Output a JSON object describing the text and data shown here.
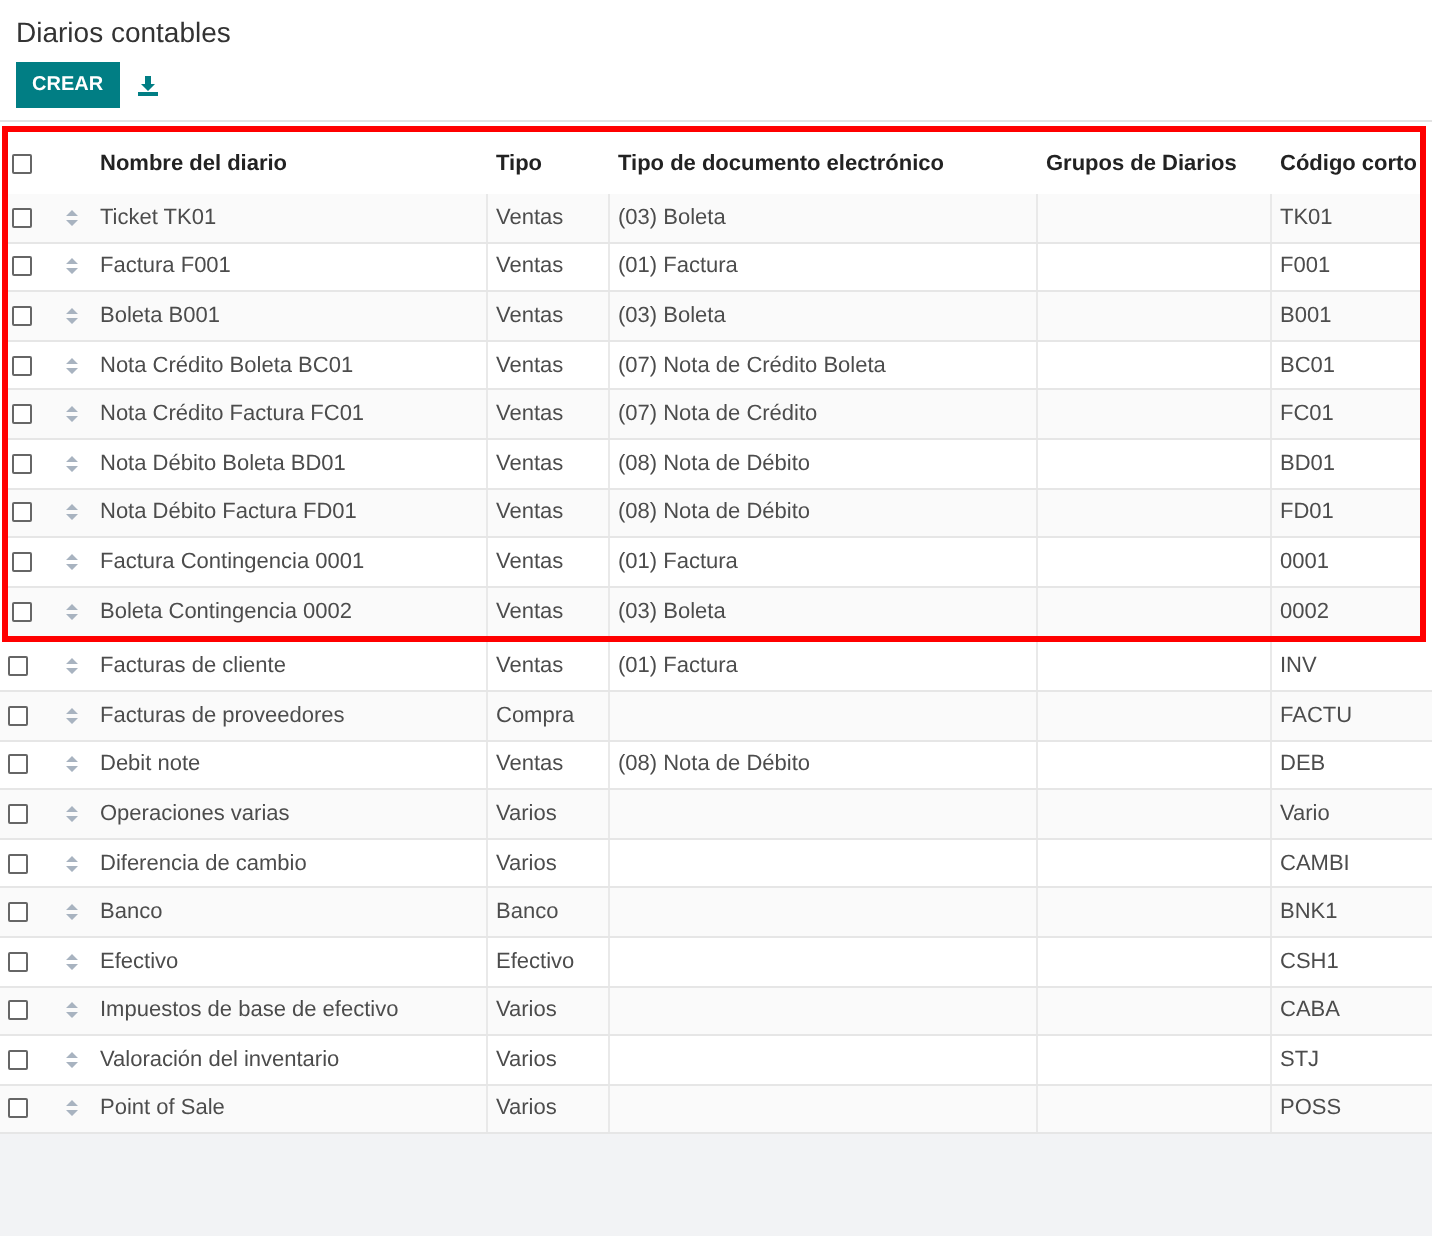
{
  "title": "Diarios contables",
  "create_button": "CREAR",
  "select_all": {
    "selected": false
  },
  "columns": [
    "Nombre del diario",
    "Tipo",
    "Tipo de documento electrónico",
    "Grupos de Diarios",
    "Código corto"
  ],
  "rows": [
    {
      "name": "Ticket TK01",
      "type": "Ventas",
      "document_type": "(03) Boleta",
      "code": "TK01",
      "selected": false,
      "highlighted": true
    },
    {
      "name": "Factura F001",
      "type": "Ventas",
      "document_type": "(01) Factura",
      "code": "F001",
      "selected": false,
      "highlighted": true
    },
    {
      "name": "Boleta B001",
      "type": "Ventas",
      "document_type": "(03) Boleta",
      "code": "B001",
      "selected": false,
      "highlighted": true
    },
    {
      "name": "Nota Crédito Boleta BC01",
      "type": "Ventas",
      "document_type": "(07) Nota de Crédito Boleta",
      "code": "BC01",
      "selected": false,
      "highlighted": true
    },
    {
      "name": "Nota Crédito Factura FC01",
      "type": "Ventas",
      "document_type": "(07) Nota de Crédito",
      "code": "FC01",
      "selected": false,
      "highlighted": true
    },
    {
      "name": "Nota Débito Boleta BD01",
      "type": "Ventas",
      "document_type": "(08) Nota de Débito",
      "code": "BD01",
      "selected": false,
      "highlighted": true
    },
    {
      "name": "Nota Débito Factura FD01",
      "type": "Ventas",
      "document_type": "(08) Nota de Débito",
      "code": "FD01",
      "selected": false,
      "highlighted": true
    },
    {
      "name": "Factura Contingencia 0001",
      "type": "Ventas",
      "document_type": "(01) Factura",
      "code": "0001",
      "selected": false,
      "highlighted": true
    },
    {
      "name": "Boleta Contingencia 0002",
      "type": "Ventas",
      "document_type": "(03) Boleta",
      "code": "0002",
      "selected": false,
      "highlighted": true
    },
    {
      "name": "Facturas de cliente",
      "type": "Ventas",
      "document_type": "(01) Factura",
      "code": "INV",
      "selected": false,
      "highlighted": false
    },
    {
      "name": "Facturas de proveedores",
      "type": "Compra",
      "code": "FACTU",
      "selected": false,
      "highlighted": false
    },
    {
      "name": "Debit note",
      "type": "Ventas",
      "document_type": "(08) Nota de Débito",
      "code": "DEB",
      "selected": false,
      "highlighted": false
    },
    {
      "name": "Operaciones varias",
      "type": "Varios",
      "code": "Vario",
      "selected": false,
      "highlighted": false
    },
    {
      "name": "Diferencia de cambio",
      "type": "Varios",
      "code": "CAMBI",
      "selected": false,
      "highlighted": false
    },
    {
      "name": "Banco",
      "type": "Banco",
      "code": "BNK1",
      "selected": false,
      "highlighted": false
    },
    {
      "name": "Efectivo",
      "type": "Efectivo",
      "code": "CSH1",
      "selected": false,
      "highlighted": false
    },
    {
      "name": "Impuestos de base de efectivo",
      "type": "Varios",
      "code": "CABA",
      "selected": false,
      "highlighted": false
    },
    {
      "name": "Valoración del inventario",
      "type": "Varios",
      "code": "STJ",
      "selected": false,
      "highlighted": false
    },
    {
      "name": "Point of Sale",
      "type": "Varios",
      "code": "POSS",
      "selected": false,
      "highlighted": false
    }
  ]
}
